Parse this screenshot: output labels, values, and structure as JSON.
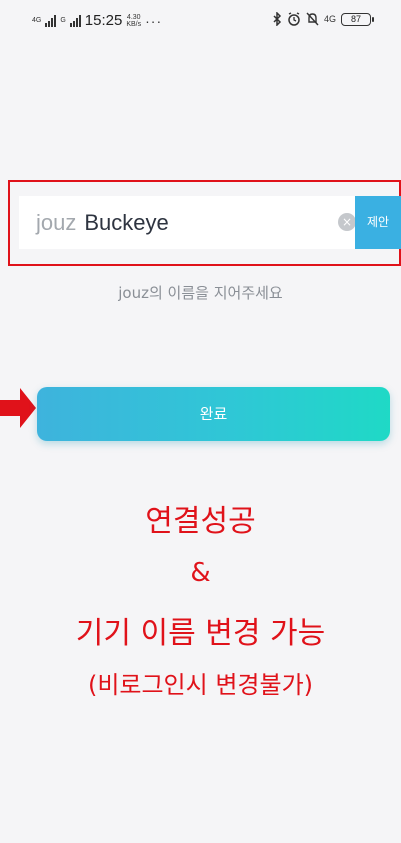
{
  "status_bar": {
    "signal1_label": "4G",
    "signal2_label": "G",
    "time": "15:25",
    "speed_value": "4.30",
    "speed_unit": "KB/s",
    "more_dots": "···",
    "network_type": "4G",
    "battery_level": "87",
    "icons": [
      "bluetooth-icon",
      "alarm-icon",
      "mute-icon",
      "signal-icon"
    ]
  },
  "name_field": {
    "prefix": "jouz",
    "value": "Buckeye",
    "clear_icon": "×",
    "suggest_label": "제안"
  },
  "hint_text": "jouz의 이름을 지어주세요",
  "done_button": {
    "label": "완료"
  },
  "annotations": {
    "line1": "연결성공",
    "line2": "&",
    "line3": "기기 이름 변경 가능",
    "line4": "(비로그인시 변경불가)"
  },
  "colors": {
    "annotation_red": "#e0121a",
    "suggest_blue": "#3ab0e2",
    "button_gradient_start": "#3eb3dd",
    "button_gradient_end": "#1fd9c6",
    "background": "#f5f5f7"
  }
}
